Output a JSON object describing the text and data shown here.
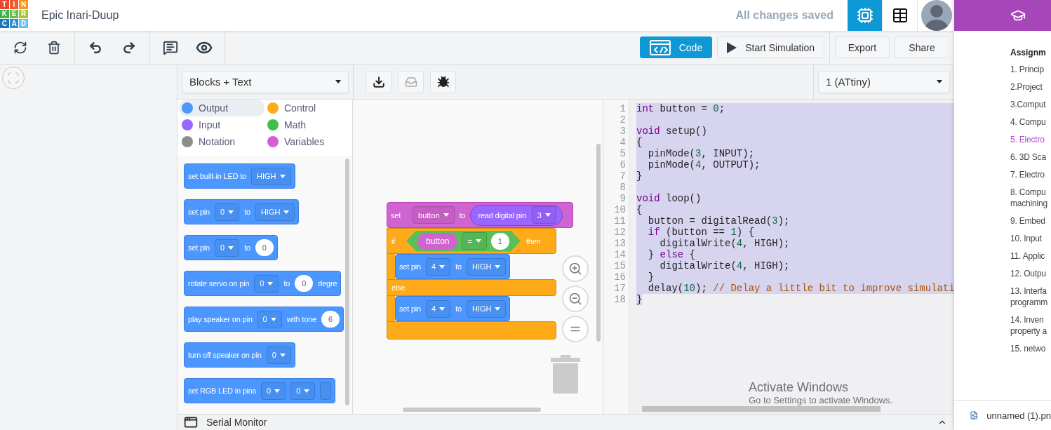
{
  "header": {
    "logo_letters": [
      {
        "text": "T",
        "color": "#e8462f"
      },
      {
        "text": "I",
        "color": "#ef5a2b"
      },
      {
        "text": "N",
        "color": "#f7941d"
      },
      {
        "text": "K",
        "color": "#39b54a"
      },
      {
        "text": "E",
        "color": "#66bc46"
      },
      {
        "text": "R",
        "color": "#a6c43a"
      },
      {
        "text": "C",
        "color": "#1c75bc"
      },
      {
        "text": "A",
        "color": "#2b8fd6"
      },
      {
        "text": "D",
        "color": "#6ec0ea"
      }
    ],
    "title": "Epic Inari-Duup",
    "save_status": "All changes saved",
    "view_buttons": [
      {
        "kind": "circuit",
        "selected": true
      },
      {
        "kind": "schematic",
        "selected": false
      }
    ]
  },
  "toolbar": {
    "groups": [
      [
        {
          "kind": "rotate"
        },
        {
          "kind": "delete"
        }
      ],
      [
        {
          "kind": "undo"
        },
        {
          "kind": "redo"
        }
      ],
      [
        {
          "kind": "notes"
        },
        {
          "kind": "visibility"
        }
      ]
    ],
    "actions": [
      {
        "kind": "code",
        "label": "Code",
        "selected": true
      },
      {
        "kind": "simulate",
        "label": "Start Simulation",
        "selected": false
      },
      {
        "kind": "plain",
        "label": "Export",
        "selected": false
      },
      {
        "kind": "plain",
        "label": "Share",
        "selected": false
      }
    ]
  },
  "code_panel": {
    "mode": "Blocks + Text",
    "tools": [
      {
        "kind": "download"
      },
      {
        "kind": "upload"
      },
      {
        "kind": "debug"
      }
    ],
    "device": "1 (ATtiny)",
    "categories": [
      {
        "label": "Output",
        "color": "#4c97ff",
        "selected": true
      },
      {
        "label": "Control",
        "color": "#ffab19",
        "selected": false
      },
      {
        "label": "Input",
        "color": "#9966ff",
        "selected": false
      },
      {
        "label": "Math",
        "color": "#40bf4a",
        "selected": false
      },
      {
        "label": "Notation",
        "color": "#8c8c8c",
        "selected": false
      },
      {
        "label": "Variables",
        "color": "#d65cd6",
        "selected": false
      }
    ],
    "palette": [
      {
        "parts": [
          {
            "kind": "text",
            "text": "set built-in LED to"
          },
          {
            "kind": "dropdown",
            "text": "HIGH"
          }
        ]
      },
      {
        "parts": [
          {
            "kind": "text",
            "text": "set pin"
          },
          {
            "kind": "dropdown",
            "text": "0"
          },
          {
            "kind": "text",
            "text": "to"
          },
          {
            "kind": "dropdown",
            "text": "HIGH"
          }
        ]
      },
      {
        "parts": [
          {
            "kind": "text",
            "text": "set pin"
          },
          {
            "kind": "dropdown",
            "text": "0"
          },
          {
            "kind": "text",
            "text": "to"
          },
          {
            "kind": "number",
            "text": "0"
          }
        ]
      },
      {
        "parts": [
          {
            "kind": "text",
            "text": "rotate servo on pin"
          },
          {
            "kind": "dropdown",
            "text": "0"
          },
          {
            "kind": "text",
            "text": "to"
          },
          {
            "kind": "number",
            "text": "0"
          },
          {
            "kind": "text",
            "text": "degre"
          }
        ]
      },
      {
        "parts": [
          {
            "kind": "text",
            "text": "play speaker on pin"
          },
          {
            "kind": "dropdown",
            "text": "0"
          },
          {
            "kind": "text",
            "text": "with tone"
          },
          {
            "kind": "number",
            "text": "6"
          }
        ]
      },
      {
        "parts": [
          {
            "kind": "text",
            "text": "turn off speaker on pin"
          },
          {
            "kind": "dropdown",
            "text": "0"
          }
        ]
      },
      {
        "parts": [
          {
            "kind": "text",
            "text": "set RGB LED in pins"
          },
          {
            "kind": "dropdown",
            "text": "0"
          },
          {
            "kind": "dropdown",
            "text": "0"
          },
          {
            "kind": "dropdown-stub"
          }
        ]
      }
    ],
    "script": {
      "set": {
        "label": "set",
        "variable": "button",
        "to": "to",
        "reporter": "read digital pin",
        "pin": "3"
      },
      "if_block": {
        "if": "if",
        "variable": "button",
        "operator": "=",
        "value": "1",
        "then": "then",
        "else": "else"
      },
      "then_block": [
        {
          "kind": "text",
          "text": "set pin"
        },
        {
          "kind": "dropdown",
          "text": "4"
        },
        {
          "kind": "text",
          "text": "to"
        },
        {
          "kind": "dropdown",
          "text": "HIGH"
        }
      ],
      "else_block": [
        {
          "kind": "text",
          "text": "set pin"
        },
        {
          "kind": "dropdown",
          "text": "4"
        },
        {
          "kind": "text",
          "text": "to"
        },
        {
          "kind": "dropdown",
          "text": "HIGH"
        }
      ]
    },
    "code_lines": [
      {
        "number": "1",
        "selected": true,
        "tokens": [
          {
            "kind": "keyword",
            "text": "int"
          },
          {
            "kind": "plain",
            "text": " button = "
          },
          {
            "kind": "number",
            "text": "0"
          },
          {
            "kind": "plain",
            "text": ";"
          }
        ]
      },
      {
        "number": "2",
        "selected": true
      },
      {
        "number": "3",
        "selected": true,
        "tokens": [
          {
            "kind": "keyword",
            "text": "void"
          },
          {
            "kind": "plain",
            "text": " setup()"
          }
        ]
      },
      {
        "number": "4",
        "selected": true,
        "tokens": [
          {
            "kind": "plain",
            "text": "{"
          }
        ]
      },
      {
        "number": "5",
        "selected": true,
        "tokens": [
          {
            "kind": "plain",
            "text": "  pinMode("
          },
          {
            "kind": "number",
            "text": "3"
          },
          {
            "kind": "plain",
            "text": ", INPUT);"
          }
        ]
      },
      {
        "number": "6",
        "selected": true,
        "tokens": [
          {
            "kind": "plain",
            "text": "  pinMode("
          },
          {
            "kind": "number",
            "text": "4"
          },
          {
            "kind": "plain",
            "text": ", OUTPUT);"
          }
        ]
      },
      {
        "number": "7",
        "selected": true,
        "tokens": [
          {
            "kind": "plain",
            "text": "}"
          }
        ]
      },
      {
        "number": "8",
        "selected": true
      },
      {
        "number": "9",
        "selected": true,
        "tokens": [
          {
            "kind": "keyword",
            "text": "void"
          },
          {
            "kind": "plain",
            "text": " loop()"
          }
        ]
      },
      {
        "number": "10",
        "selected": true,
        "tokens": [
          {
            "kind": "plain",
            "text": "{"
          }
        ]
      },
      {
        "number": "11",
        "selected": true,
        "tokens": [
          {
            "kind": "plain",
            "text": "  button = digitalRead("
          },
          {
            "kind": "number",
            "text": "3"
          },
          {
            "kind": "plain",
            "text": ");"
          }
        ]
      },
      {
        "number": "12",
        "selected": true,
        "tokens": [
          {
            "kind": "keyword",
            "text": "  if"
          },
          {
            "kind": "plain",
            "text": " (button == "
          },
          {
            "kind": "number",
            "text": "1"
          },
          {
            "kind": "plain",
            "text": ") {"
          }
        ]
      },
      {
        "number": "13",
        "selected": true,
        "tokens": [
          {
            "kind": "plain",
            "text": "    digitalWrite("
          },
          {
            "kind": "number",
            "text": "4"
          },
          {
            "kind": "plain",
            "text": ", HIGH);"
          }
        ]
      },
      {
        "number": "14",
        "selected": true,
        "tokens": [
          {
            "kind": "plain",
            "text": "  } "
          },
          {
            "kind": "keyword",
            "text": "else"
          },
          {
            "kind": "plain",
            "text": " {"
          }
        ]
      },
      {
        "number": "15",
        "selected": true,
        "tokens": [
          {
            "kind": "plain",
            "text": "    digitalWrite("
          },
          {
            "kind": "number",
            "text": "4"
          },
          {
            "kind": "plain",
            "text": ", HIGH);"
          }
        ]
      },
      {
        "number": "16",
        "selected": true,
        "tokens": [
          {
            "kind": "plain",
            "text": "  }"
          }
        ]
      },
      {
        "number": "17",
        "selected": true,
        "tokens": [
          {
            "kind": "plain",
            "text": "  delay("
          },
          {
            "kind": "number",
            "text": "10"
          },
          {
            "kind": "plain",
            "text": "); "
          },
          {
            "kind": "comment",
            "text": "// Delay a little bit to improve simulati"
          }
        ]
      },
      {
        "number": "18",
        "selected": false,
        "tokens": [
          {
            "kind": "plain",
            "text": "}",
            "selected": true
          }
        ]
      }
    ]
  },
  "serial_monitor": {
    "label": "Serial Monitor"
  },
  "os_notice": {
    "title": "Activate Windows",
    "subtitle": "Go to Settings to activate Windows."
  },
  "side_panel": {
    "heading": "Assignm",
    "items": [
      {
        "lines": [
          "1. Princip"
        ],
        "selected": false
      },
      {
        "lines": [
          "2.Project"
        ],
        "selected": false
      },
      {
        "lines": [
          "3.Comput"
        ],
        "selected": false
      },
      {
        "lines": [
          "4. Compu"
        ],
        "selected": false
      },
      {
        "lines": [
          "5. Electro"
        ],
        "selected": true
      },
      {
        "lines": [
          "6. 3D Sca"
        ],
        "selected": false
      },
      {
        "lines": [
          "7. Electro"
        ],
        "selected": false
      },
      {
        "lines": [
          "8. Compu",
          "machining"
        ],
        "selected": false
      },
      {
        "lines": [
          "9. Embed"
        ],
        "selected": false
      },
      {
        "lines": [
          "10. Input"
        ],
        "selected": false
      },
      {
        "lines": [
          "11. Applic"
        ],
        "selected": false
      },
      {
        "lines": [
          "12. Outpu"
        ],
        "selected": false
      },
      {
        "lines": [
          "13. Interfa",
          "programm"
        ],
        "selected": false
      },
      {
        "lines": [
          "14. Inven",
          "property a"
        ],
        "selected": false
      },
      {
        "lines": [
          "15. netwo"
        ],
        "selected": false
      }
    ],
    "download": {
      "filename": "unnamed (1).pn"
    }
  }
}
